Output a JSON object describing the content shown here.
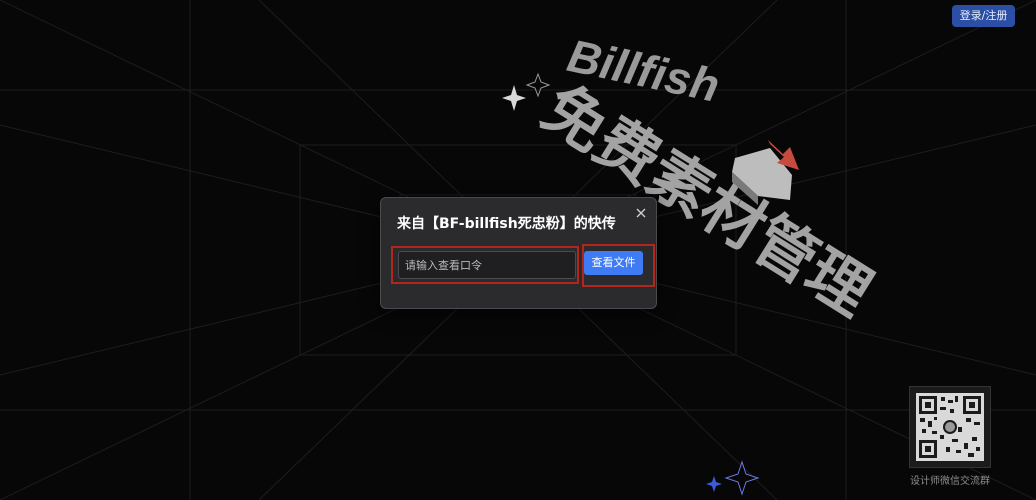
{
  "header": {
    "login_register_label": "登录/注册"
  },
  "hero": {
    "brand_word": "Billfish",
    "headline": "免费素材管理"
  },
  "modal": {
    "title": "来自【BF-billfish死忠粉】的快传",
    "input_placeholder": "请输入查看口令",
    "input_value": "",
    "view_button_label": "查看文件"
  },
  "footer": {
    "qr_caption": "设计师微信交流群"
  },
  "colors": {
    "background": "#070707",
    "primary_button": "#3f7bf5",
    "login_button": "#2c4fa6",
    "highlight_border": "#b3261e"
  }
}
